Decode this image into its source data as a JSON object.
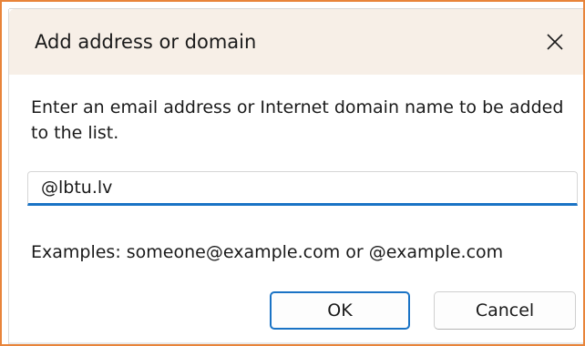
{
  "dialog": {
    "title": "Add address or domain",
    "prompt": "Enter an email address or Internet domain name to be added to the list.",
    "input_value": "@lbtu.lv",
    "examples": "Examples: someone@example.com or @example.com",
    "ok_label": "OK",
    "cancel_label": "Cancel",
    "close_icon": "close-icon"
  },
  "colors": {
    "accent": "#1a73c5",
    "titlebar": "#f7efe7",
    "window_border": "#e8843a"
  }
}
